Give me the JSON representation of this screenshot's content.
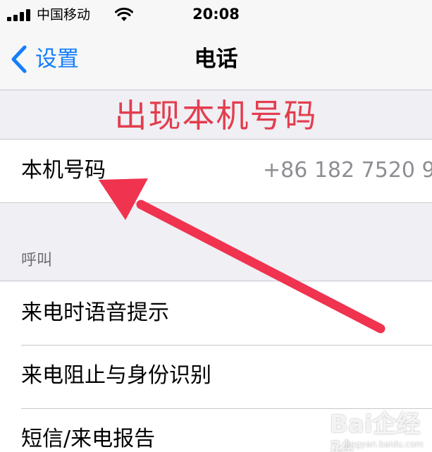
{
  "status_bar": {
    "carrier": "中国移动",
    "time": "20:08"
  },
  "nav": {
    "back_label": "设置",
    "title": "电话"
  },
  "annotation": {
    "banner_text": "出现本机号码",
    "banner_color": "#e33d4e",
    "arrow_color": "#f0334f"
  },
  "my_number_row": {
    "label": "本机号码",
    "value": "+86 182 7520 9"
  },
  "calls_section": {
    "header": "呼叫",
    "items": [
      {
        "label": "来电时语音提示"
      },
      {
        "label": "来电阻止与身份识别"
      },
      {
        "label": "短信/来电报告"
      }
    ]
  },
  "watermark": {
    "text": "Bai企经验",
    "sub": "jingyan.baidu.com"
  },
  "colors": {
    "accent": "#147efb",
    "background": "#efeff4",
    "separator": "#c8c7cc",
    "secondary_text": "#8e8e93"
  }
}
